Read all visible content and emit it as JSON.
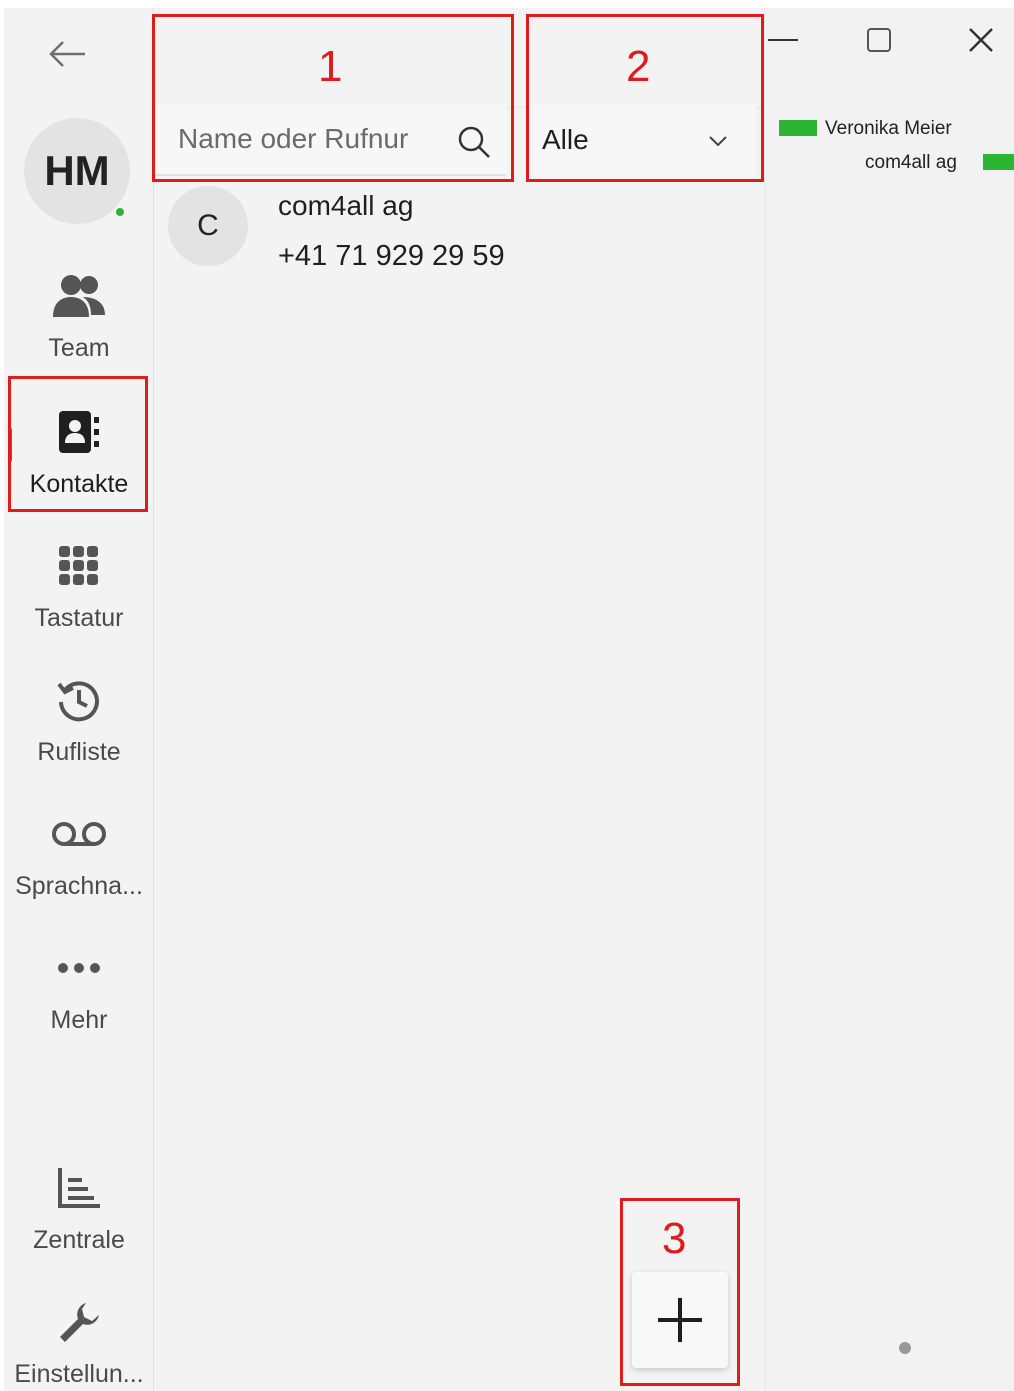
{
  "sidebar": {
    "avatar_initials": "HM",
    "presence_color": "#2bb533",
    "items": [
      {
        "label": "Team",
        "icon": "people-icon"
      },
      {
        "label": "Kontakte",
        "icon": "contact-book-icon",
        "active": true
      },
      {
        "label": "Tastatur",
        "icon": "dialpad-icon"
      },
      {
        "label": "Rufliste",
        "icon": "history-icon"
      },
      {
        "label": "Sprachna...",
        "icon": "voicemail-icon"
      },
      {
        "label": "Mehr",
        "icon": "more-dots-icon"
      },
      {
        "label": "Zentrale",
        "icon": "bar-chart-icon"
      },
      {
        "label": "Einstellun...",
        "icon": "wrench-icon"
      }
    ]
  },
  "search": {
    "placeholder": "Name oder Rufnur"
  },
  "filter": {
    "selected": "Alle"
  },
  "contacts": [
    {
      "initial": "C",
      "name": "com4all ag",
      "phone": "+41 71 929 29 59"
    }
  ],
  "right_panel": {
    "line1": "Veronika Meier",
    "line2": "com4all ag",
    "status_color": "#2bb533"
  },
  "annotations": {
    "one": "1",
    "two": "2",
    "three": "3",
    "color": "#e01b1b"
  }
}
